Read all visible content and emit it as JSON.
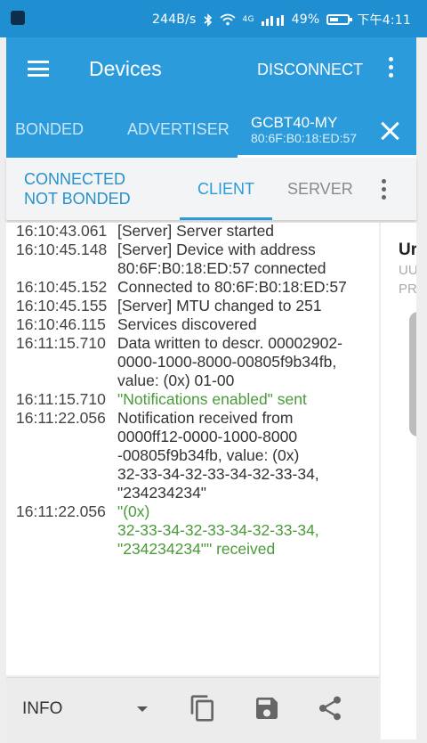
{
  "status_bar": {
    "speed": "244B/s",
    "network": "4G",
    "battery_text": "49%",
    "battery_level": 0.49,
    "time": "下午4:11"
  },
  "app_bar": {
    "title": "Devices",
    "disconnect_label": "DISCONNECT"
  },
  "tabs": {
    "bonded": "BONDED",
    "advertiser": "ADVERTISER",
    "device_name": "GCBT40-MY",
    "device_address": "80:6F:B0:18:ED:57"
  },
  "connection": {
    "state": "CONNECTED",
    "bond_state": "NOT BONDED",
    "client_tab": "CLIENT",
    "server_tab": "SERVER"
  },
  "log": [
    {
      "time": "16:10:43.061",
      "msg": "[Server] Server started",
      "type": "normal"
    },
    {
      "time": "16:10:45.148",
      "msg": "[Server] Device with address",
      "type": "normal"
    },
    {
      "time": "",
      "msg": "80:6F:B0:18:ED:57 connected",
      "type": "normal"
    },
    {
      "time": "16:10:45.152",
      "msg": "Connected to 80:6F:B0:18:ED:57",
      "type": "normal"
    },
    {
      "time": "16:10:45.155",
      "msg": "[Server] MTU changed to 251",
      "type": "normal"
    },
    {
      "time": "16:10:46.115",
      "msg": "Services discovered",
      "type": "normal"
    },
    {
      "time": "16:11:15.710",
      "msg": "Data written to descr. 00002902-",
      "type": "normal"
    },
    {
      "time": "",
      "msg": "0000-1000-8000-00805f9b34fb,",
      "type": "normal"
    },
    {
      "time": "",
      "msg": "value: (0x) 01-00",
      "type": "normal"
    },
    {
      "time": "16:11:15.710",
      "msg": "\"Notifications enabled\" sent",
      "type": "green"
    },
    {
      "time": "16:11:22.056",
      "msg": "Notification received from",
      "type": "normal"
    },
    {
      "time": "",
      "msg": "0000ff12-0000-1000-8000",
      "type": "normal"
    },
    {
      "time": "",
      "msg": "-00805f9b34fb, value: (0x)",
      "type": "normal"
    },
    {
      "time": "",
      "msg": "32-33-34-32-33-34-32-33-34,",
      "type": "normal"
    },
    {
      "time": "",
      "msg": "\"234234234\"",
      "type": "normal"
    },
    {
      "time": "16:11:22.056",
      "msg": "\"(0x)",
      "type": "green"
    },
    {
      "time": "",
      "msg": "32-33-34-32-33-34-32-33-34,",
      "type": "green"
    },
    {
      "time": "",
      "msg": "\"234234234\"\" received",
      "type": "green"
    }
  ],
  "side_panel": {
    "title": "Ur",
    "line1": "UU",
    "line2": "PR"
  },
  "bottom_bar": {
    "log_level": "INFO"
  },
  "colors": {
    "primary": "#2b9bdc",
    "status_bar": "#1f8fd1",
    "log_green": "#4a9a3a"
  },
  "icons": [
    "menu-icon",
    "overflow-icon",
    "close-icon",
    "dropdown-arrow-icon",
    "copy-icon",
    "save-icon",
    "share-icon"
  ]
}
